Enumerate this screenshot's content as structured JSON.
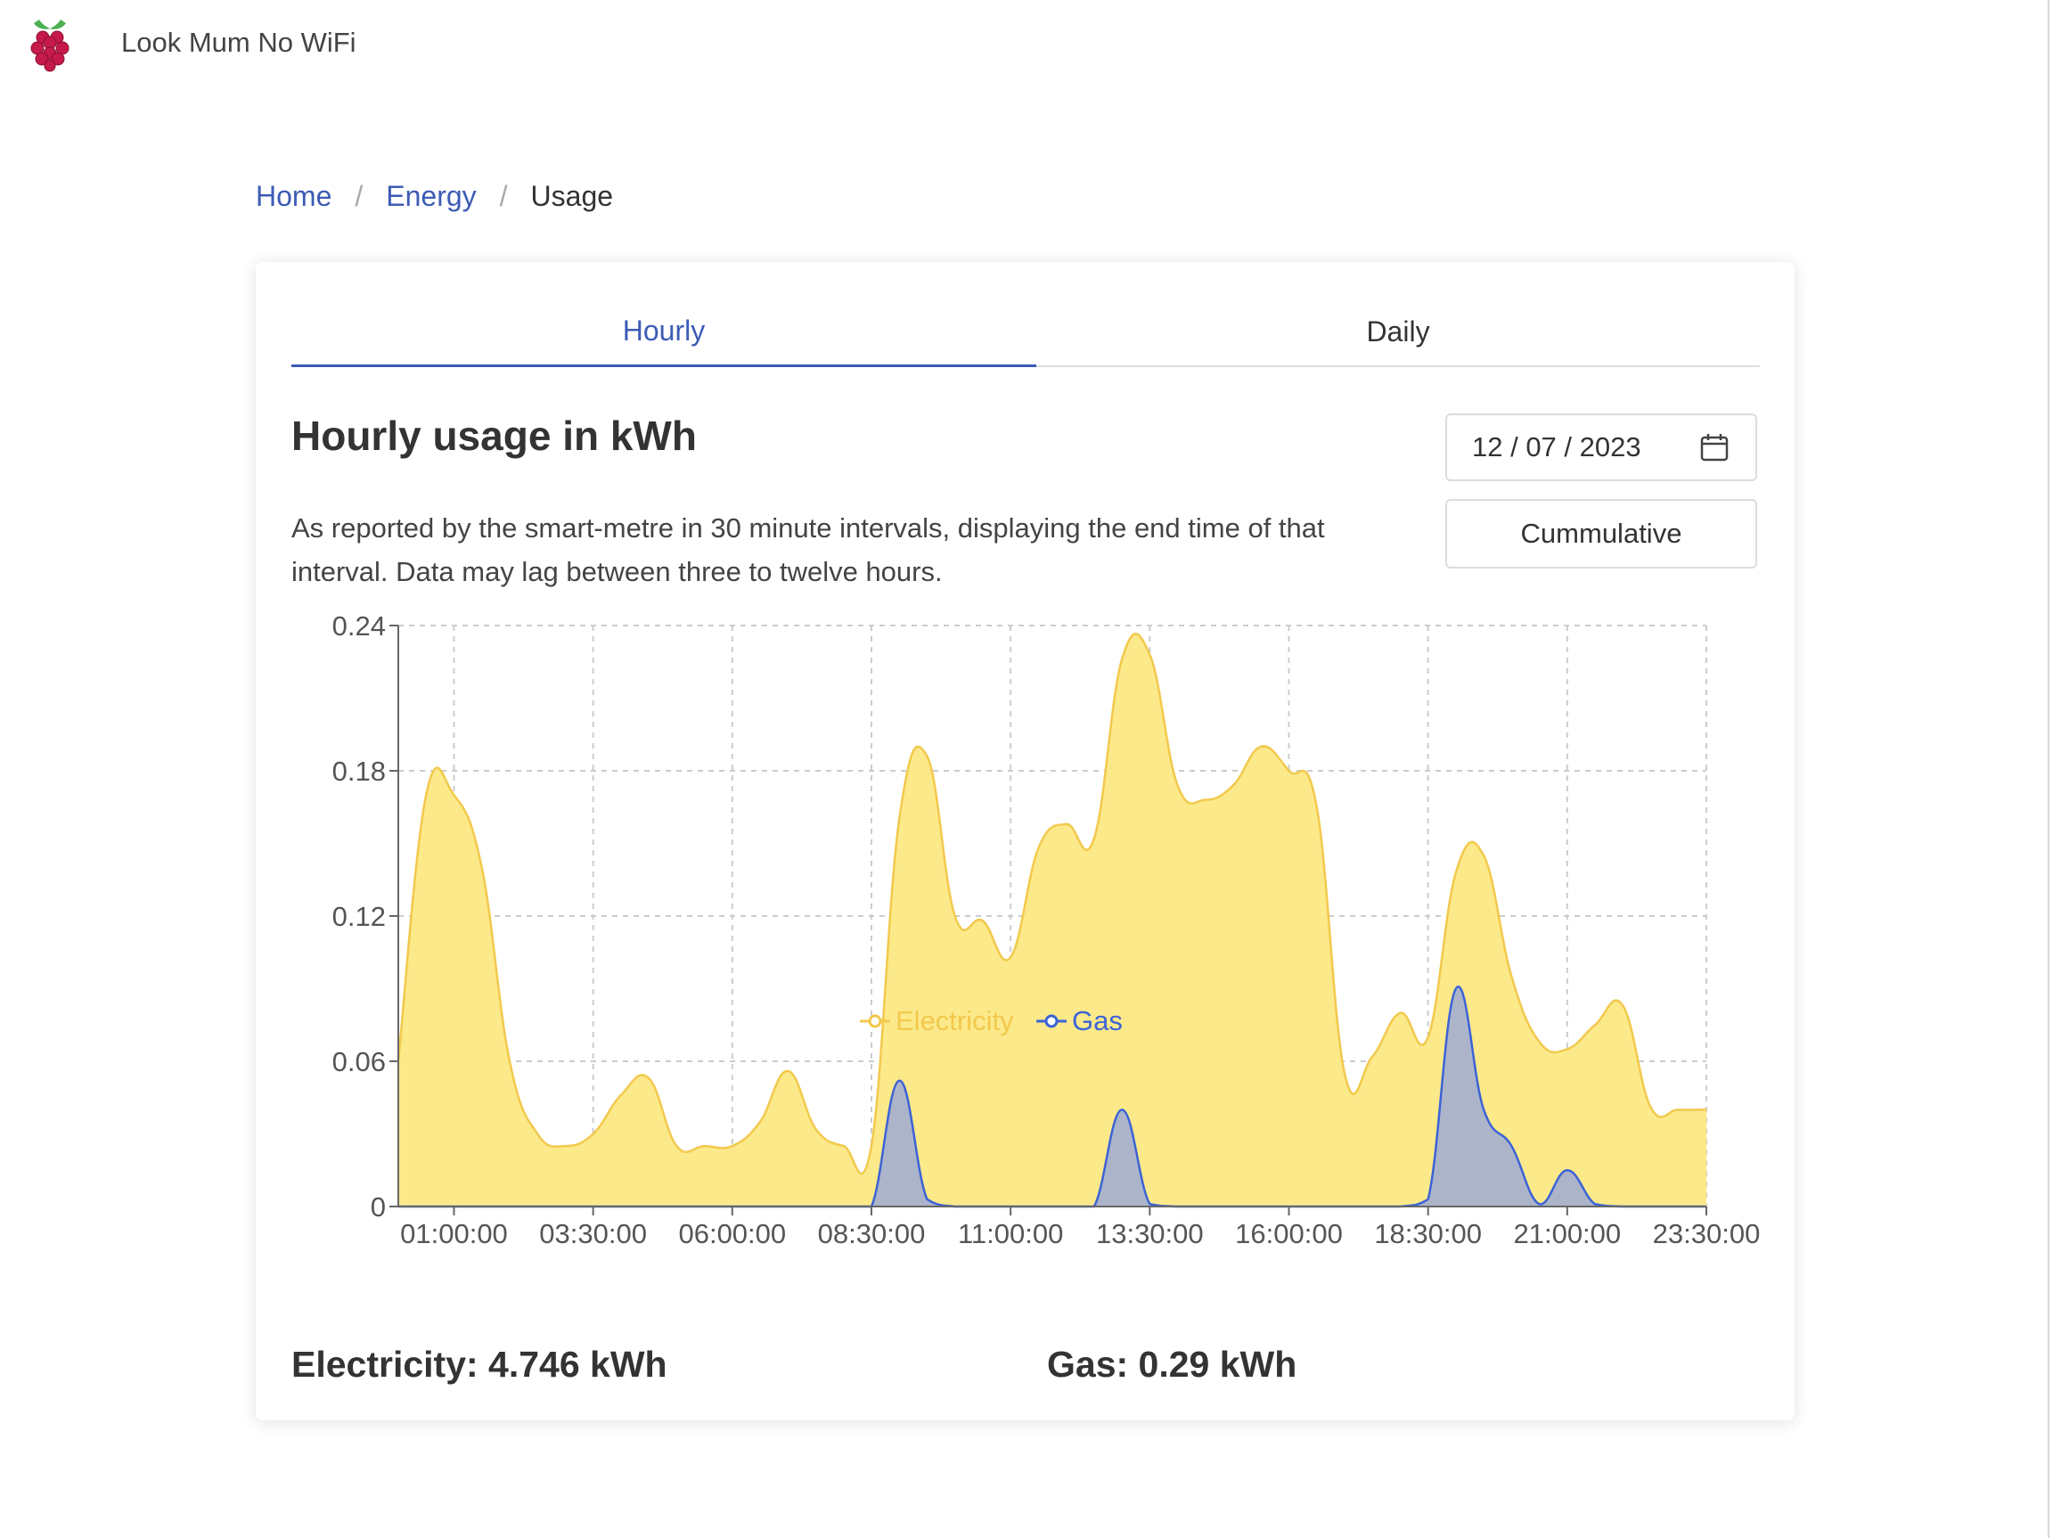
{
  "app": {
    "title": "Look Mum No WiFi"
  },
  "breadcrumb": {
    "items": [
      "Home",
      "Energy"
    ],
    "current": "Usage"
  },
  "tabs": {
    "hourly": "Hourly",
    "daily": "Daily",
    "active": "Hourly"
  },
  "heading": "Hourly usage in kWh",
  "description": "As reported by the smart-metre in 30 minute intervals, displaying the end time of that interval. Data may lag between three to twelve hours.",
  "date_input": {
    "value": "12 / 07 / 2023"
  },
  "cumulative_button": "Cummulative",
  "totals": {
    "electricity": "Electricity: 4.746 kWh",
    "gas": "Gas: 0.29 kWh"
  },
  "colors": {
    "accent": "#3d5bb5",
    "electricity_line": "#f2c94c",
    "electricity_fill": "#fce98a",
    "gas_line": "#3c63d6",
    "gas_fill": "#a3aed0"
  },
  "chart_data": {
    "type": "area",
    "ylim": [
      0,
      0.24
    ],
    "y_ticks": [
      "0",
      "0.06",
      "0.12",
      "0.18",
      "0.24"
    ],
    "x_tick_labels": [
      "01:00:00",
      "03:30:00",
      "06:00:00",
      "08:30:00",
      "11:00:00",
      "13:30:00",
      "16:00:00",
      "18:30:00",
      "21:00:00",
      "23:30:00"
    ],
    "x": [
      "00:00:00",
      "00:30:00",
      "01:00:00",
      "01:30:00",
      "02:00:00",
      "02:30:00",
      "03:00:00",
      "03:30:00",
      "04:00:00",
      "04:30:00",
      "05:00:00",
      "05:30:00",
      "06:00:00",
      "06:30:00",
      "07:00:00",
      "07:30:00",
      "08:00:00",
      "08:30:00",
      "09:00:00",
      "09:30:00",
      "10:00:00",
      "10:30:00",
      "11:00:00",
      "11:30:00",
      "12:00:00",
      "12:30:00",
      "13:00:00",
      "13:30:00",
      "14:00:00",
      "14:30:00",
      "15:00:00",
      "15:30:00",
      "16:00:00",
      "16:30:00",
      "17:00:00",
      "17:30:00",
      "18:00:00",
      "18:30:00",
      "19:00:00",
      "19:30:00",
      "20:00:00",
      "20:30:00",
      "21:00:00",
      "21:30:00",
      "22:00:00",
      "22:30:00",
      "23:00:00",
      "23:30:00"
    ],
    "series": [
      {
        "name": "Electricity",
        "values": [
          0.06,
          0.17,
          0.17,
          0.14,
          0.06,
          0.03,
          0.025,
          0.03,
          0.046,
          0.053,
          0.025,
          0.025,
          0.025,
          0.035,
          0.056,
          0.032,
          0.025,
          0.025,
          0.16,
          0.186,
          0.12,
          0.118,
          0.103,
          0.148,
          0.158,
          0.152,
          0.226,
          0.228,
          0.174,
          0.168,
          0.174,
          0.19,
          0.18,
          0.165,
          0.055,
          0.062,
          0.08,
          0.07,
          0.138,
          0.145,
          0.095,
          0.068,
          0.065,
          0.075,
          0.083,
          0.041,
          0.04,
          0.04
        ]
      },
      {
        "name": "Gas",
        "values": [
          0,
          0,
          0,
          0,
          0,
          0,
          0,
          0,
          0,
          0,
          0,
          0,
          0,
          0,
          0,
          0,
          0,
          0,
          0.052,
          0.003,
          0,
          0,
          0,
          0,
          0,
          0,
          0.04,
          0.001,
          0,
          0,
          0,
          0,
          0,
          0,
          0,
          0,
          0,
          0.003,
          0.09,
          0.04,
          0.025,
          0.001,
          0.015,
          0.001,
          0,
          0,
          0,
          0
        ]
      }
    ],
    "legend_position": "bottom",
    "grid": true
  }
}
